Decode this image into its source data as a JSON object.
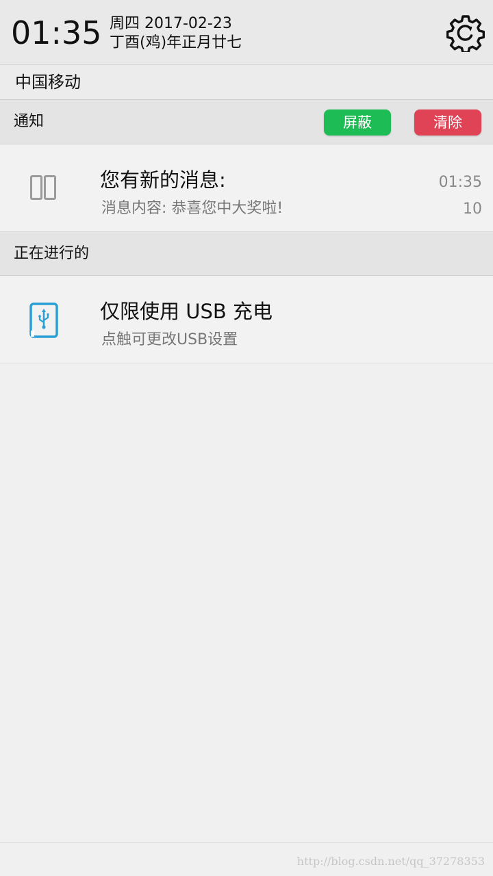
{
  "status": {
    "time": "01:35",
    "date_line": "周四 2017-02-23",
    "lunar_line": "丁酉(鸡)年正月廿七",
    "settings_icon": "gear-refresh-icon"
  },
  "carrier": {
    "name": "中国移动"
  },
  "notifications_section": {
    "title": "通知",
    "block_label": "屏蔽",
    "clear_label": "清除",
    "block_color": "#1ebc55",
    "clear_color": "#e04356"
  },
  "message_notification": {
    "icon": "message-app-icon",
    "title": "您有新的消息:",
    "content": "消息内容: 恭喜您中大奖啦!",
    "time": "01:35",
    "count": "10"
  },
  "ongoing_section": {
    "title": "正在进行的"
  },
  "usb_notification": {
    "icon": "usb-icon",
    "title": "仅限使用 USB 充电",
    "subtitle": "点触可更改USB设置",
    "icon_color": "#2a9fd6"
  },
  "watermark": {
    "text": "http://blog.csdn.net/qq_37278353"
  }
}
